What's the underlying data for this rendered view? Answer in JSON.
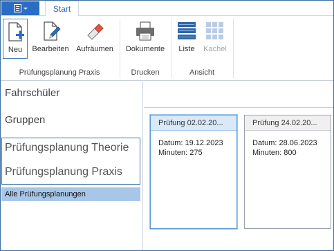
{
  "tabs": {
    "start": "Start"
  },
  "ribbon": {
    "groups": {
      "praxis": "Prüfungsplanung Praxis",
      "drucken": "Drucken",
      "ansicht": "Ansicht"
    },
    "buttons": {
      "neu": "Neu",
      "bearbeiten": "Bearbeiten",
      "aufraeumen": "Aufräumen",
      "dokumente": "Dokumente",
      "liste": "Liste",
      "kachel": "Kachel"
    }
  },
  "nav": {
    "items": [
      "Fahrschüler",
      "Gruppen",
      "Prüfungsplanung Theorie",
      "Prüfungsplanung Praxis"
    ],
    "sub_item": "Alle Prüfungsplanungen"
  },
  "cards": [
    {
      "title": "Prüfung 02.02.20...",
      "datum": "Datum: 19.12.2023",
      "minuten": "Minuten: 275"
    },
    {
      "title": "Prüfung 24.02.20...",
      "datum": "Datum: 28.06.2023",
      "minuten": "Minuten: 800"
    }
  ],
  "colors": {
    "accent": "#2b6cc4",
    "selection": "#a8c7e8",
    "border": "#3c6ea3"
  }
}
